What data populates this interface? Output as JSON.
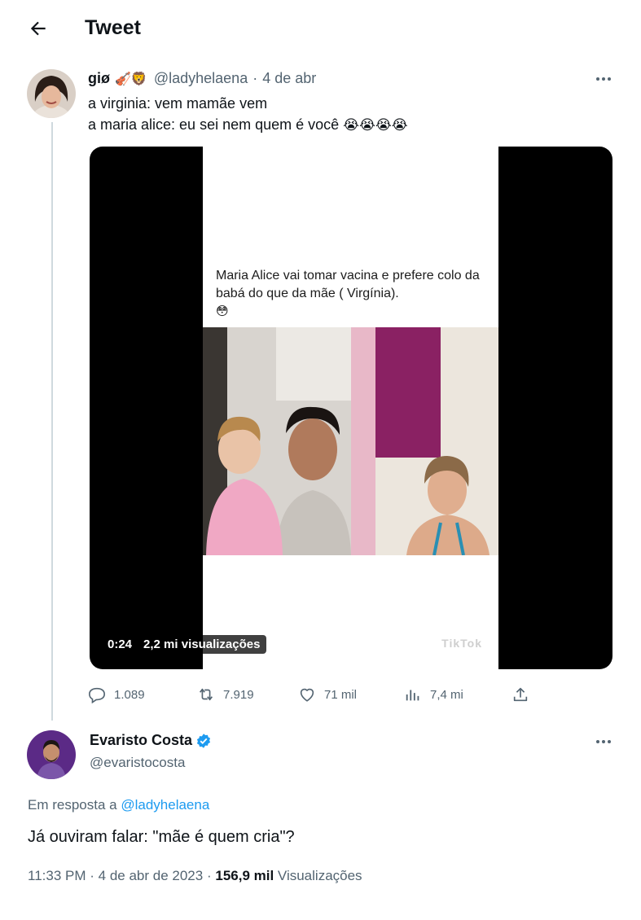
{
  "header": {
    "title": "Tweet"
  },
  "quoted_tweet": {
    "display_name": "giø",
    "name_emoji": "🎻🦁",
    "handle": "@ladyhelaena",
    "time": "4 de abr",
    "lines": [
      "a virginia: vem mamãe vem",
      "a maria alice: eu sei nem quem é você"
    ],
    "trailing_emoji": "😭😭😭😭",
    "media": {
      "caption": "Maria Alice vai tomar  vacina e prefere colo da babá do que da mãe ( Virgínia).",
      "caption_emoji": "😳",
      "watermark": "TikTok",
      "duration": "0:24",
      "views": "2,2 mi visualizações"
    },
    "stats": {
      "replies": "1.089",
      "retweets": "7.919",
      "likes": "71 mil",
      "views": "7,4 mi"
    }
  },
  "reply_tweet": {
    "display_name": "Evaristo Costa",
    "handle": "@evaristocosta",
    "reply_prefix": "Em resposta a",
    "reply_handle": "@ladyhelaena",
    "text": "Já ouviram falar: \"mãe é quem cria\"?",
    "time": "11:33 PM",
    "date": "4 de abr de 2023",
    "views_count": "156,9 mil",
    "views_label": "Visualizações"
  },
  "colors": {
    "accent": "#1d9bf0",
    "secondary_text": "#536471",
    "primary_text": "#0f1419"
  },
  "icons": {
    "back": "arrow-left-icon",
    "more": "more-horizontal-icon",
    "reply": "comment-icon",
    "retweet": "retweet-icon",
    "like": "heart-icon",
    "views": "bar-chart-icon",
    "share": "share-icon",
    "verified": "verified-badge-icon"
  }
}
